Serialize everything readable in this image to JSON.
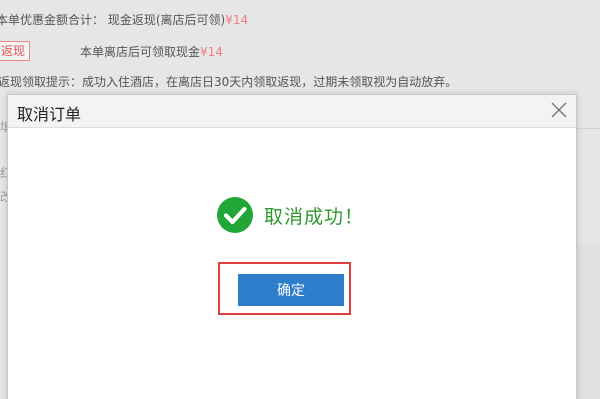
{
  "background": {
    "line1_label": "本单优惠金额合计：",
    "line1_value": "现金返现(离店后可领)",
    "line1_amount": "¥14",
    "refund_tag": "返现",
    "line2_text": "本单离店后可领取现金",
    "line2_amount": "¥14",
    "line3_text": "返现领取提示：成功入住酒店，在离店日30天内领取返现，过期未领取视为自动放弃。",
    "frag1": "填",
    "frag2": "红",
    "frag3": "改"
  },
  "dialog": {
    "title": "取消订单",
    "message": "取消成功！",
    "confirm_label": "确定"
  },
  "colors": {
    "accent_button": "#2d7ecb",
    "success_green": "#2e9a2e",
    "highlight_red": "#e04040",
    "money": "#f08080"
  },
  "icons": {
    "close": "close-icon",
    "success": "checkmark-circle-icon"
  }
}
